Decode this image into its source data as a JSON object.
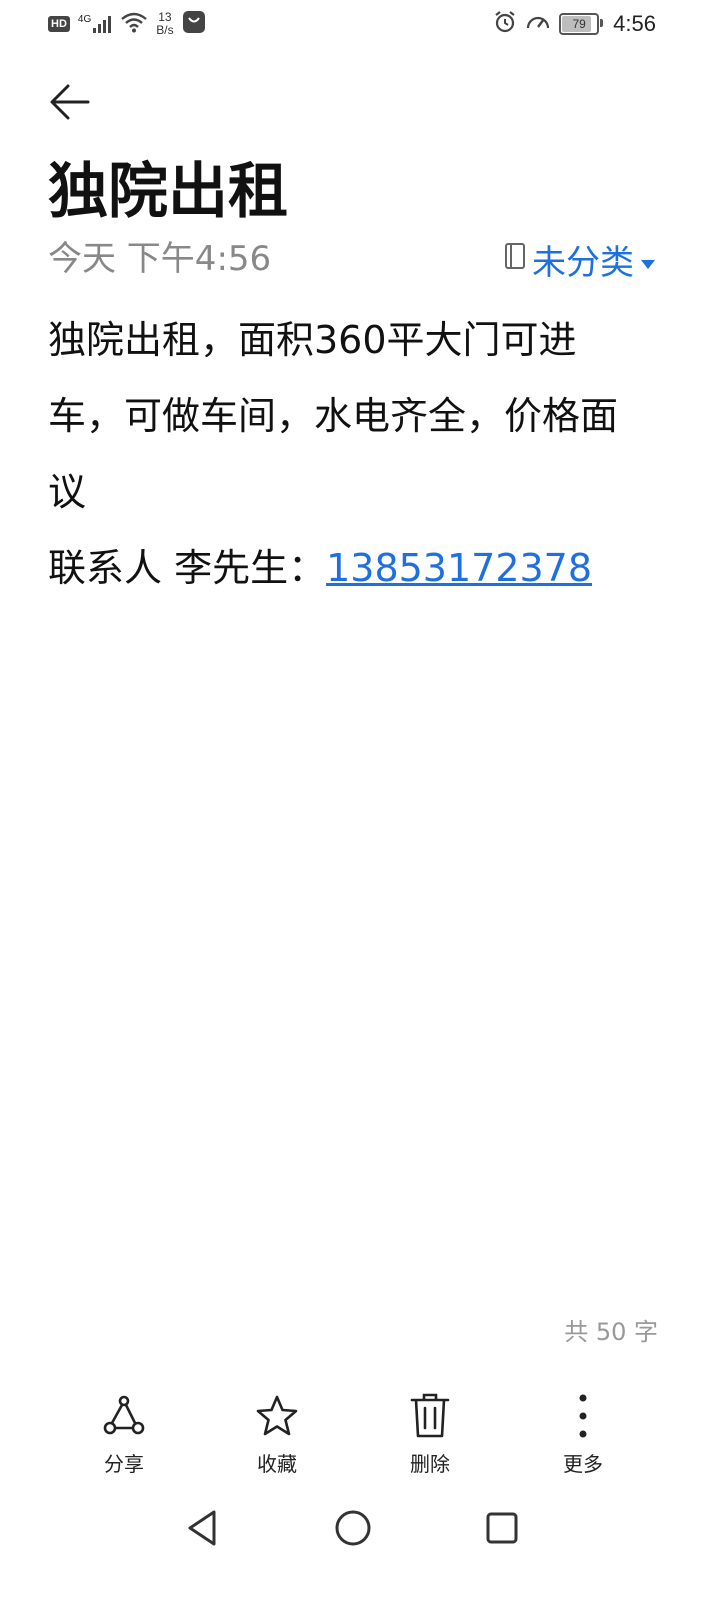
{
  "status_bar": {
    "hd_label": "HD",
    "network_type": "4G",
    "net_speed_value": "13",
    "net_speed_unit": "B/s",
    "battery_level": "79",
    "time": "4:56"
  },
  "note": {
    "title": "独院出租",
    "date": "今天 下午4:56",
    "category": "未分类",
    "body_line_1": "独院出租，面积360平大门可进车，可做车间，水电齐全，价格面议",
    "contact_prefix": "联系人 李先生：",
    "phone": "13853172378",
    "word_count": "共 50 字"
  },
  "toolbar": {
    "share_label": "分享",
    "favorite_label": "收藏",
    "delete_label": "删除",
    "more_label": "更多"
  },
  "colors": {
    "accent": "#1e6fe0",
    "text": "#111111",
    "muted": "#888888"
  }
}
